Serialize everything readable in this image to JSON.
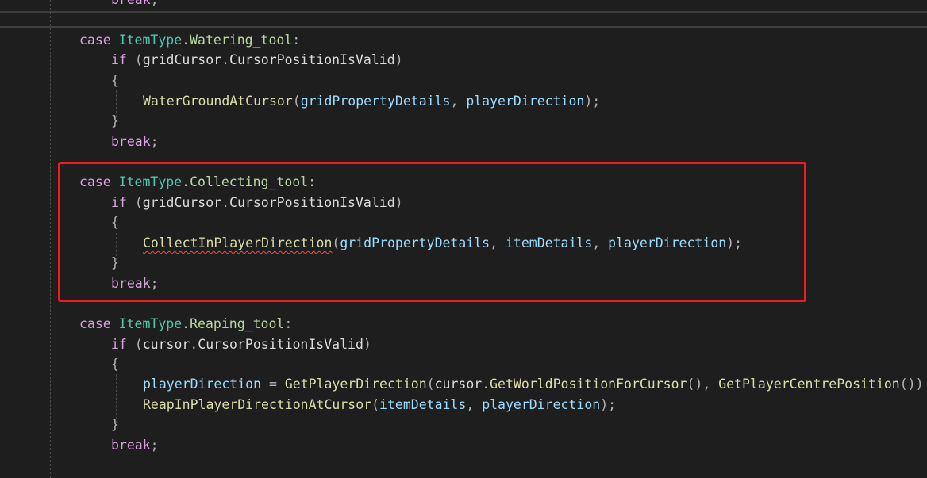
{
  "code": {
    "line_top_partial": {
      "keyword": "break",
      "punct": ";"
    },
    "watering": {
      "case_kw": "case",
      "type": "ItemType",
      "dot": ".",
      "member": "Watering_tool",
      "colon": ":",
      "if_kw": "if",
      "paren_open": "(",
      "obj": "gridCursor",
      "prop": "CursorPositionIsValid",
      "paren_close": ")",
      "brace_open": "{",
      "call_fn": "WaterGroundAtCursor",
      "arg1": "gridPropertyDetails",
      "comma": ",",
      "arg2": "playerDirection",
      "call_end": ");",
      "brace_close": "}",
      "break_kw": "break",
      "semi": ";"
    },
    "collecting": {
      "case_kw": "case",
      "type": "ItemType",
      "dot": ".",
      "member": "Collecting_tool",
      "colon": ":",
      "if_kw": "if",
      "paren_open": "(",
      "obj": "gridCursor",
      "prop": "CursorPositionIsValid",
      "paren_close": ")",
      "brace_open": "{",
      "call_fn": "CollectInPlayerDirection",
      "arg1": "gridPropertyDetails",
      "comma": ",",
      "arg2": "itemDetails",
      "arg3": "playerDirection",
      "call_end": ");",
      "brace_close": "}",
      "break_kw": "break",
      "semi": ";"
    },
    "reaping": {
      "case_kw": "case",
      "type": "ItemType",
      "dot": ".",
      "member": "Reaping_tool",
      "colon": ":",
      "if_kw": "if",
      "paren_open": "(",
      "obj": "cursor",
      "prop": "CursorPositionIsValid",
      "paren_close": ")",
      "brace_open": "{",
      "assign_var": "playerDirection",
      "assign_op": " = ",
      "fn1": "GetPlayerDirection",
      "fn1_open": "(",
      "fn1_obj": "cursor",
      "fn2": "GetWorldPositionForCursor",
      "empty_call": "()",
      "comma": ",",
      "fn3": "GetPlayerCentrePosition",
      "fn3_tail": "())",
      "call2_fn": "ReapInPlayerDirectionAtCursor",
      "call2_open": "(",
      "call2_arg1": "itemDetails",
      "call2_arg2": "playerDirection",
      "call_end": ");",
      "brace_close": "}",
      "break_kw": "break",
      "semi": ";"
    }
  },
  "colors": {
    "background": "#1e1e1e",
    "highlight_box": "#f21c1c",
    "error_squiggle": "#f14c4c"
  }
}
